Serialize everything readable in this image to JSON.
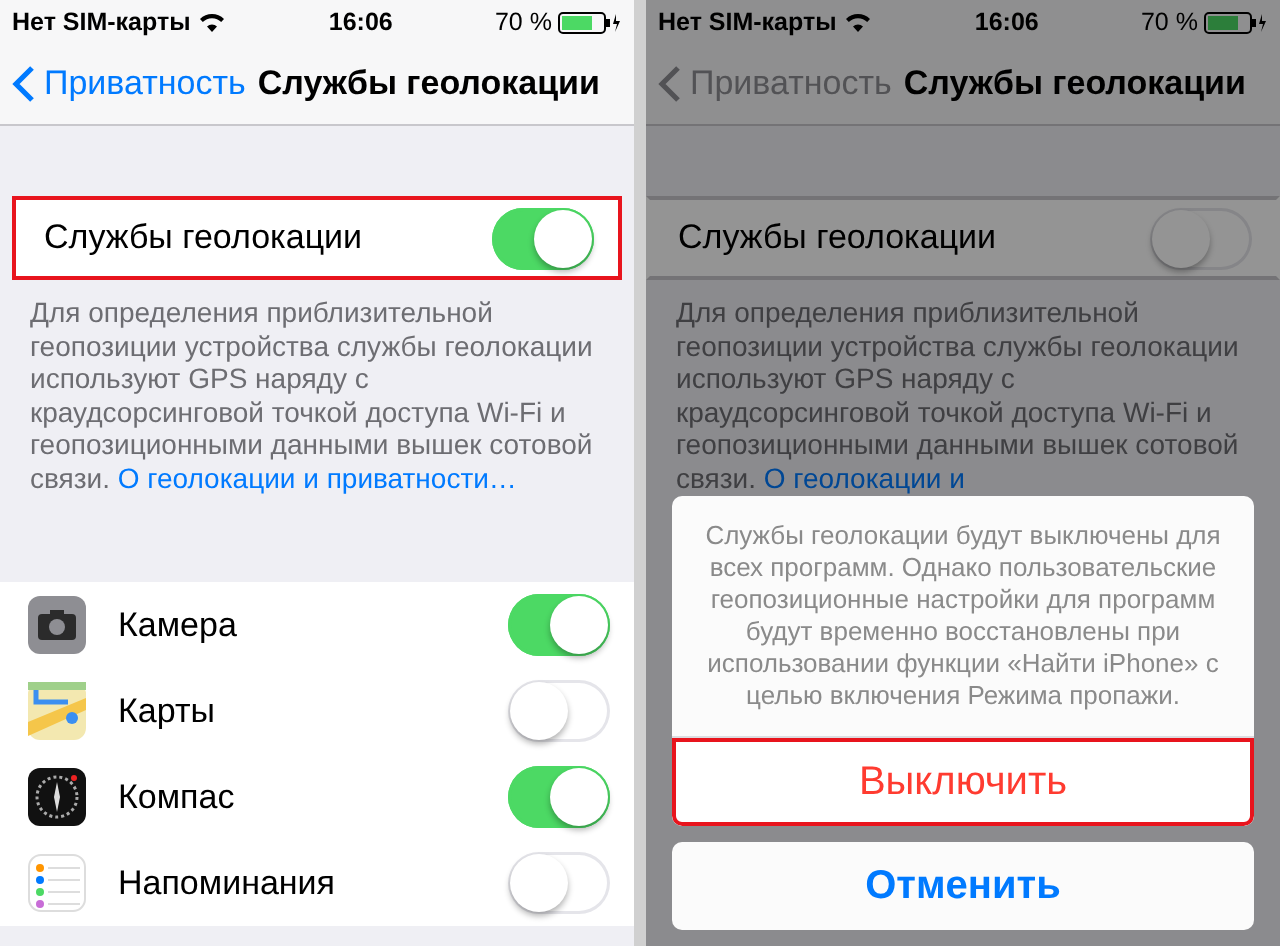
{
  "screens": [
    {
      "dimmed": false,
      "status_bar": {
        "carrier": "Нет SIM-карты",
        "time": "16:06",
        "battery": "70 %"
      },
      "nav": {
        "back": "Приватность",
        "title": "Службы геолокации"
      },
      "master_toggle": {
        "label": "Службы геолокации",
        "on": true,
        "highlighted": true
      },
      "description": {
        "text": "Для определения приблизительной геопозиции устройства службы геолокации используют GPS наряду с краудсорсинговой точкой доступа Wi‑Fi и геопозиционными данными вышек сотовой связи.",
        "link": "О геолокации и приватности…"
      },
      "apps": [
        {
          "name": "Камера",
          "kind": "camera",
          "on": true
        },
        {
          "name": "Карты",
          "kind": "maps",
          "on": false
        },
        {
          "name": "Компас",
          "kind": "compass",
          "on": true
        },
        {
          "name": "Напоминания",
          "kind": "reminders",
          "on": false
        }
      ]
    },
    {
      "dimmed": true,
      "status_bar": {
        "carrier": "Нет SIM-карты",
        "time": "16:06",
        "battery": "70 %"
      },
      "nav": {
        "back": "Приватность",
        "title": "Службы геолокации"
      },
      "master_toggle": {
        "label": "Службы геолокации",
        "on": false,
        "highlighted": false
      },
      "description": {
        "text": "Для определения приблизительной геопозиции устройства службы геолокации используют GPS наряду с краудсорсинговой точкой доступа Wi‑Fi и геопозиционными данными вышек сотовой связи.",
        "link": "О геолокации и"
      },
      "alert": {
        "message": "Службы геолокации будут выключены для всех программ. Однако пользовательские геопозиционные настройки для программ будут временно восстановлены при использовании функции «Найти iPhone» с целью включения Режима пропажи.",
        "actions": [
          {
            "label": "Выключить",
            "kind": "destructive",
            "highlighted": true
          },
          {
            "label": "Отменить",
            "kind": "cancel",
            "highlighted": false
          }
        ]
      }
    }
  ]
}
